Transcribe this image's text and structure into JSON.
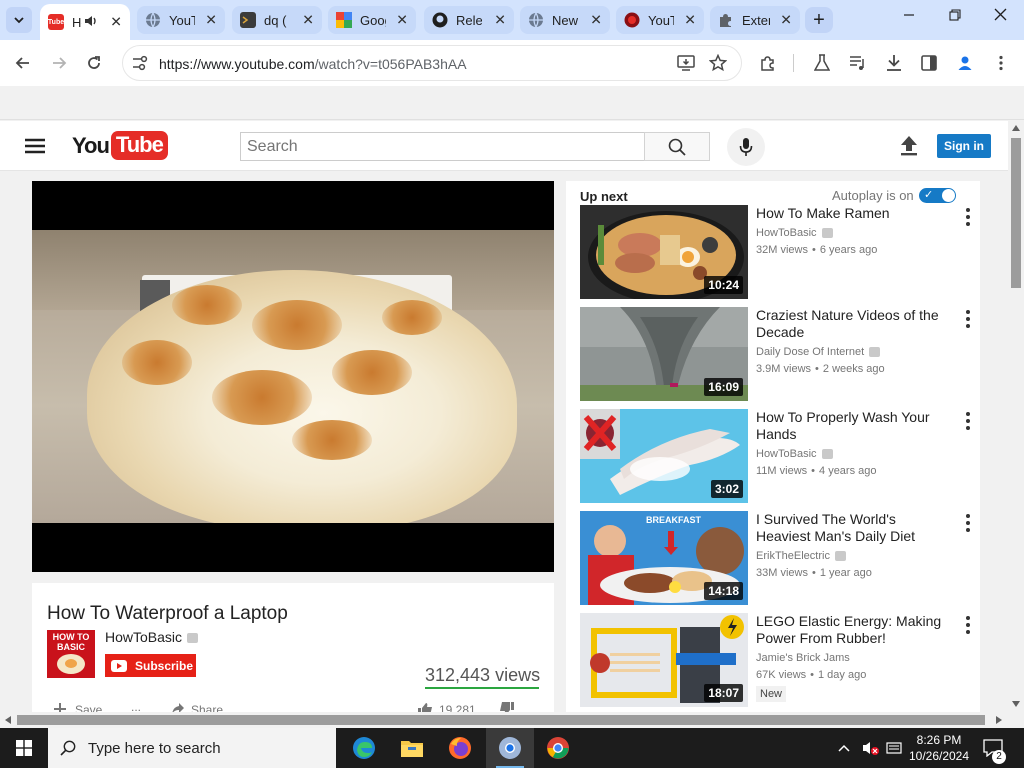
{
  "browser": {
    "tabs": [
      {
        "title": "How To Waterproof a Laptop",
        "favicon": "youtube-favicon",
        "active": true
      },
      {
        "title": "YouTube",
        "favicon": "globe-favicon"
      },
      {
        "title": "dq (",
        "favicon": "terminal-favicon"
      },
      {
        "title": "Google",
        "favicon": "google-favicon"
      },
      {
        "title": "Releases",
        "favicon": "github-favicon"
      },
      {
        "title": "New Tab",
        "favicon": "globe-favicon"
      },
      {
        "title": "YouTube",
        "favicon": "youtube-red-favicon"
      },
      {
        "title": "Extensions",
        "favicon": "puzzle-favicon"
      }
    ],
    "url_host": "https://www.youtube.com",
    "url_rest": "/watch?v=t056PAB3hAA"
  },
  "youtube": {
    "logo_you": "You",
    "logo_tube": "Tube",
    "search_placeholder": "Search",
    "sign_in_label": "Sign in"
  },
  "video": {
    "title": "How To Waterproof a Laptop",
    "channel_thumb_text": "HOW TO BASIC",
    "channel": "HowToBasic",
    "subscribe_label": "Subscribe",
    "views": "312,443 views",
    "save_label": "Save",
    "more_label": "...",
    "share_label": "Share",
    "likes": "19,281"
  },
  "upnext": {
    "header": "Up next",
    "autoplay_label": "Autoplay is on",
    "autoplay_on": true,
    "items": [
      {
        "title": "How To Make Ramen",
        "channel": "HowToBasic",
        "views": "32M views",
        "age": "6 years ago",
        "duration": "10:24",
        "verified": true
      },
      {
        "title": "Craziest Nature Videos of the Decade",
        "channel": "Daily Dose Of Internet",
        "views": "3.9M views",
        "age": "2 weeks ago",
        "duration": "16:09",
        "verified": true
      },
      {
        "title": "How To Properly Wash Your Hands",
        "channel": "HowToBasic",
        "views": "11M views",
        "age": "4 years ago",
        "duration": "3:02",
        "verified": true
      },
      {
        "title": "I Survived The World's Heaviest Man's Daily Diet",
        "channel": "ErikTheElectric",
        "views": "33M views",
        "age": "1 year ago",
        "duration": "14:18",
        "verified": true,
        "thumb_caption": "BREAKFAST"
      },
      {
        "title": "LEGO Elastic Energy: Making Power From Rubber!",
        "channel": "Jamie's Brick Jams",
        "views": "67K views",
        "age": "1 day ago",
        "duration": "18:07",
        "verified": false,
        "badge": "New"
      }
    ]
  },
  "taskbar": {
    "search_placeholder": "Type here to search",
    "time": "8:26 PM",
    "date": "10/26/2024",
    "notification_count": "2"
  },
  "colors": {
    "youtube_red": "#e52d27",
    "subscribe_red": "#e62117",
    "link_blue": "#167ac6",
    "like_green": "#2ba640",
    "chrome_tabstrip": "#d3e3fd"
  }
}
